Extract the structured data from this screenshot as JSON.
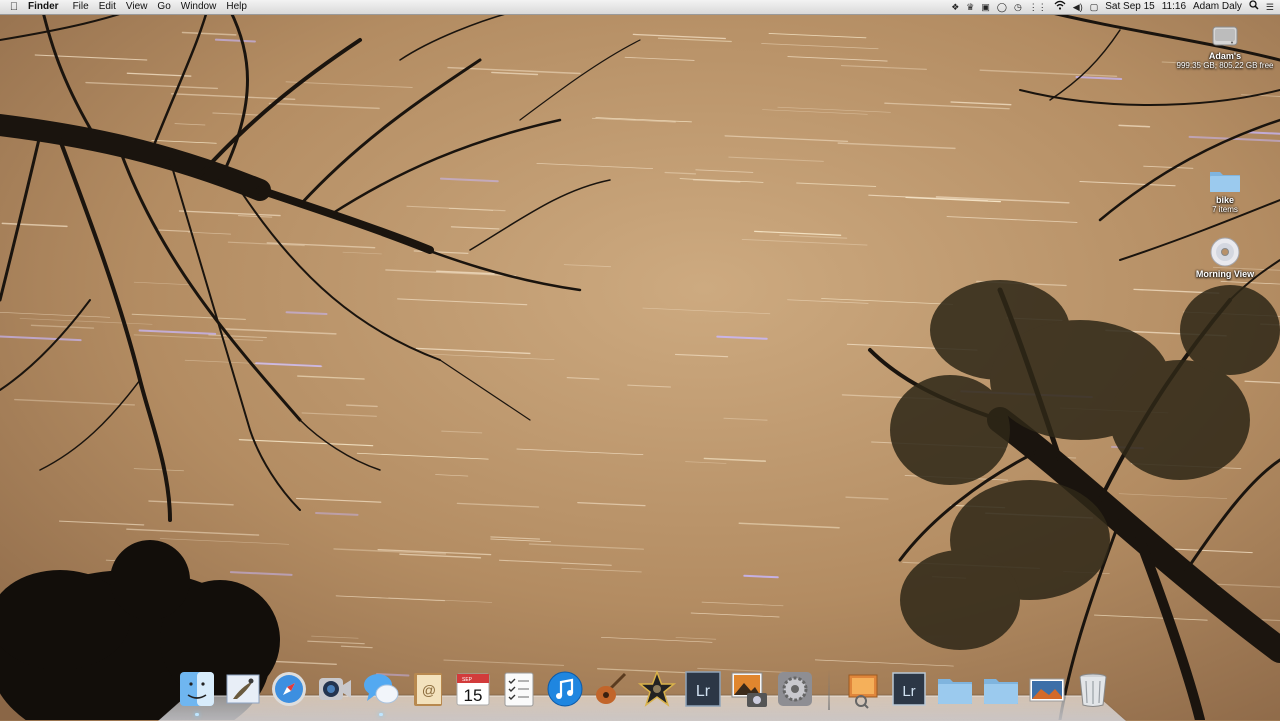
{
  "menubar": {
    "app": "Finder",
    "menus": [
      "File",
      "Edit",
      "View",
      "Go",
      "Window",
      "Help"
    ],
    "date": "Sat Sep 15",
    "time": "11:16",
    "user": "Adam Daly",
    "status_icons": [
      "dropbox-icon",
      "evernote-icon",
      "skype-icon",
      "chat-icon",
      "time-machine-icon",
      "bluetooth-icon",
      "wifi-icon",
      "volume-icon",
      "flag-icon",
      "spotlight-icon",
      "notification-center-icon"
    ]
  },
  "desktop": {
    "hard_drive": {
      "name": "Adam's",
      "detail": "999.35 GB, 805.22 GB free"
    },
    "folder": {
      "name": "bike",
      "detail": "7 items"
    },
    "disc": {
      "name": "Morning View"
    }
  },
  "calendar_icon": {
    "month": "SEP",
    "day": "15"
  },
  "dock": {
    "apps": [
      "finder",
      "mail",
      "safari",
      "facetime",
      "messages",
      "contacts",
      "calendar",
      "reminders",
      "itunes",
      "garageband",
      "imovie",
      "lightroom",
      "iphoto",
      "system-preferences"
    ],
    "right": [
      "preview",
      "lightroom-doc",
      "documents-folder",
      "downloads-folder",
      "photo-stack",
      "trash"
    ]
  },
  "colors": {
    "sky": "#b8916a",
    "branches": "#1a140e",
    "menubar": "#e6e6e6",
    "folder": "#8fc1e8"
  }
}
